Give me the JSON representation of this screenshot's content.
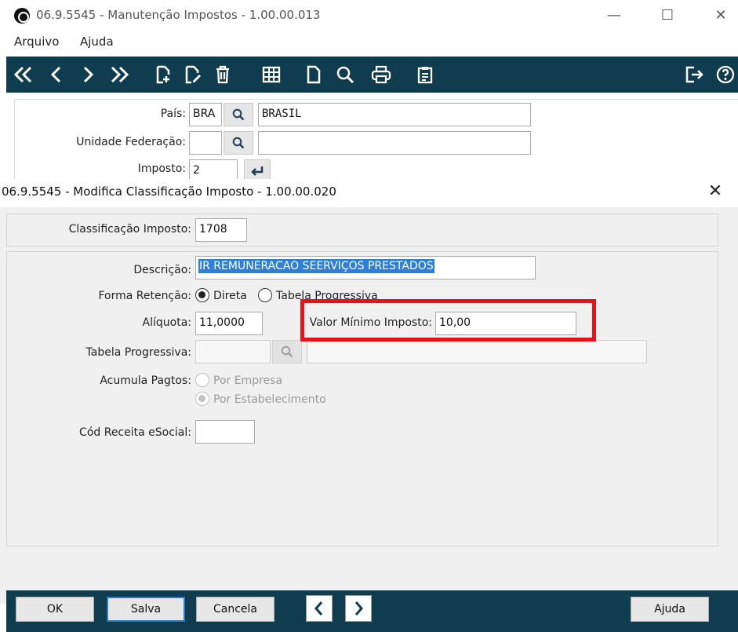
{
  "parent_window": {
    "title": "06.9.5545 - Manutenção Impostos - 1.00.00.013",
    "controls": {
      "minimize": "—",
      "maximize": "☐",
      "close": "✕"
    },
    "menu": [
      "Arquivo",
      "Ajuda"
    ],
    "toolbar_icons": [
      "first-icon",
      "prev-icon",
      "next-icon",
      "last-icon",
      "new-icon",
      "edit-icon",
      "delete-icon",
      "grid-icon",
      "copy-icon",
      "search-icon",
      "print-icon",
      "clipboard-icon",
      "exit-icon",
      "help-icon"
    ],
    "form": {
      "pais_label": "País:",
      "pais_code": "BRA",
      "pais_name": "BRASIL",
      "uf_label": "Unidade Federação:",
      "uf_code": "",
      "uf_name": "",
      "imposto_label": "Imposto:",
      "imposto_value": "2"
    }
  },
  "modal": {
    "title": "06.9.5545 - Modifica Classificação Imposto - 1.00.00.020",
    "close": "✕",
    "classificacao_label": "Classificação Imposto:",
    "classificacao_value": "1708",
    "descricao_label": "Descrição:",
    "descricao_value": "IR REMUNERACAO SEERVIÇOS PRESTADOS",
    "forma_retencao_label": "Forma Retenção:",
    "forma_retencao_options": [
      {
        "label": "Direta",
        "checked": true
      },
      {
        "label": "Tabela Progressiva",
        "checked": false
      }
    ],
    "aliquota_label": "Alíquota:",
    "aliquota_value": "11,0000",
    "valor_minimo_label": "Valor Mínimo Imposto:",
    "valor_minimo_value": "10,00",
    "tabela_progressiva_label": "Tabela Progressiva:",
    "tabela_progressiva_code": "",
    "tabela_progressiva_desc": "",
    "acumula_pagtos_label": "Acumula Pagtos:",
    "acumula_pagtos_options": [
      {
        "label": "Por Empresa",
        "checked": false
      },
      {
        "label": "Por Estabelecimento",
        "checked": true
      }
    ],
    "cod_receita_label": "Cód Receita eSocial:",
    "cod_receita_value": "",
    "buttons": {
      "ok": "OK",
      "salva": "Salva",
      "cancela": "Cancela",
      "ajuda": "Ajuda"
    }
  },
  "colors": {
    "toolbar_bg": "#103c50",
    "highlight": "#e8111a",
    "selection": "#2f7fd8",
    "focus_border": "#2b78c4"
  }
}
